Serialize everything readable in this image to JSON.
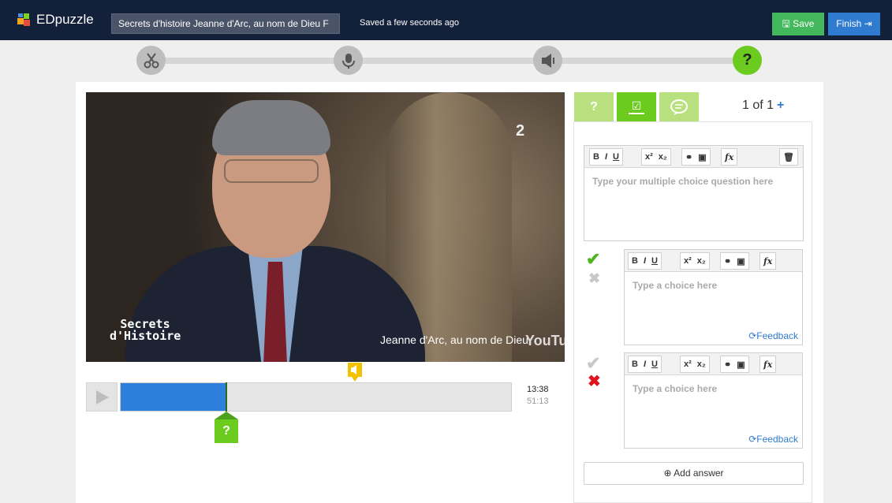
{
  "app": {
    "name": "EDpuzzle"
  },
  "header": {
    "video_title": "Secrets d'histoire  Jeanne d'Arc, au nom de Dieu F",
    "status": "Saved a few seconds ago",
    "save_label": "Save",
    "finish_label": "Finish"
  },
  "steps": [
    {
      "icon": "scissors-icon",
      "state": "done"
    },
    {
      "icon": "microphone-icon",
      "state": "done"
    },
    {
      "icon": "speaker-icon",
      "state": "done"
    },
    {
      "icon": "question-icon",
      "state": "active",
      "label": "?"
    }
  ],
  "video": {
    "channel_logo": "2",
    "show_title": "Secrets d'Histoire",
    "caption": "Jeanne d'Arc, au nom de Dieu",
    "watermark": "YouTube"
  },
  "player": {
    "current_time": "13:38",
    "total_time": "51:13",
    "progress_fraction": 0.268,
    "question_marker_label": "?"
  },
  "question_panel": {
    "tabs": [
      {
        "name": "open-ended",
        "label": "?"
      },
      {
        "name": "multiple-choice",
        "label": "✓"
      },
      {
        "name": "comment",
        "label": "💬"
      }
    ],
    "pager": "1 of 1",
    "pager_add": "+",
    "toolbar_buttons": {
      "bold": "B",
      "italic": "I",
      "underline": "U",
      "sup": "x²",
      "sub": "x₂",
      "fx": "fx"
    },
    "question_placeholder": "Type your multiple choice question here",
    "choices": [
      {
        "placeholder": "Type a choice here",
        "correct": true,
        "feedback_label": "Feedback"
      },
      {
        "placeholder": "Type a choice here",
        "correct": false,
        "feedback_label": "Feedback"
      }
    ],
    "add_answer_label": "Add answer"
  },
  "colors": {
    "topbar": "#13203a",
    "green": "#6bcb1f",
    "blue": "#2f7bcf",
    "progress": "#2d7fdb",
    "audio_marker": "#f2c200"
  }
}
